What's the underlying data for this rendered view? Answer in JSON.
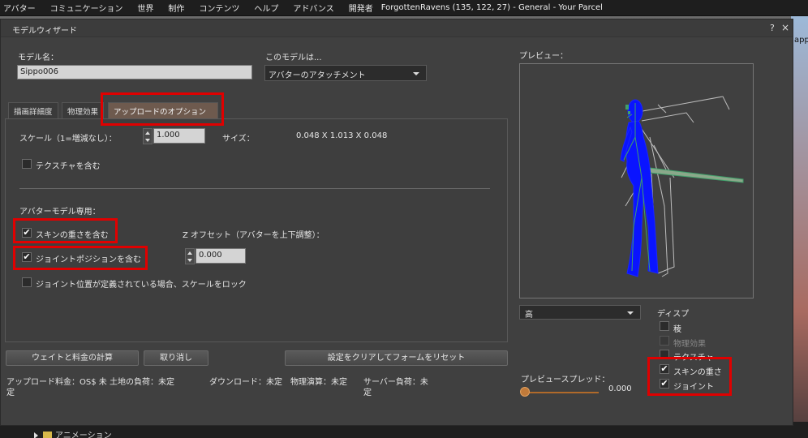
{
  "menubar": {
    "items": [
      "アバター",
      "コミュニケーション",
      "世界",
      "制作",
      "コンテンツ",
      "ヘルプ",
      "アドバンス",
      "開発者"
    ],
    "location": "ForgottenRavens (135, 122, 27) - General - Your Parcel"
  },
  "background": {
    "right_text": "app",
    "inventory_item": "アニメーション"
  },
  "window": {
    "title": "モデルウィザード",
    "help": "?",
    "close": "×"
  },
  "model": {
    "name_label": "モデル名：",
    "name_value": "Sippo006",
    "type_label": "このモデルは...",
    "type_value": "アバターのアタッチメント"
  },
  "tabs": [
    {
      "label": "描画詳細度",
      "active": false
    },
    {
      "label": "物理効果",
      "active": false
    },
    {
      "label": "アップロードのオプション",
      "active": true
    }
  ],
  "options": {
    "scale_label": "スケール（1=増減なし）：",
    "scale_value": "1.000",
    "size_label": "サイズ：",
    "size_value": "0.048 X 1.013 X 0.048",
    "include_textures": "テクスチャを含む",
    "avatar_section": "アバターモデル専用：",
    "include_skin_weight": "スキンの重さを含む",
    "include_joint_positions": "ジョイントポジションを含む",
    "lock_scale": "ジョイント位置が定義されている場合、スケールをロック",
    "z_offset_label": "Z オフセット（アバターを上下調整）：",
    "z_offset_value": "0.000"
  },
  "buttons": {
    "calculate": "ウェイトと料金の計算",
    "cancel": "取り消し",
    "reset": "設定をクリアしてフォームをリセット"
  },
  "status": {
    "upload_fee": "アップロード料金：OS$ 未 土地の負荷：未定",
    "upload_fee_2": "定",
    "download": "ダウンロード：未定",
    "physics": "物理演算：未定",
    "server": "サーバー負荷：未",
    "server_2": "定"
  },
  "preview": {
    "label": "プレビュー：",
    "quality_value": "高",
    "display_label": "ディスプ",
    "edges": "稜",
    "physics": "物理効果",
    "textures": "テクスチャ",
    "skin_weight": "スキンの重さ",
    "joints": "ジョイント",
    "spread_label": "プレビュースプレッド：",
    "spread_value": "0.000"
  },
  "colors": {
    "highlight": "#e00000",
    "active_tab": "#6e5a4e",
    "avatar": "#0a14ff",
    "bone": "#3fa06a"
  },
  "check_mark": "✔"
}
